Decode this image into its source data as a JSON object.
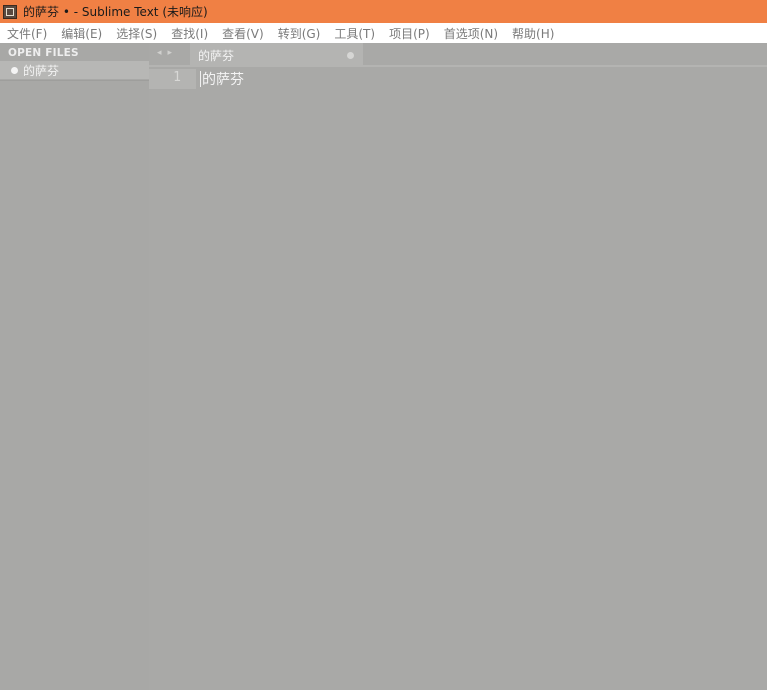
{
  "window": {
    "title": "的萨芬 • - Sublime Text (未响应)"
  },
  "menu": {
    "items": [
      {
        "label": "文件(F)"
      },
      {
        "label": "编辑(E)"
      },
      {
        "label": "选择(S)"
      },
      {
        "label": "查找(I)"
      },
      {
        "label": "查看(V)"
      },
      {
        "label": "转到(G)"
      },
      {
        "label": "工具(T)"
      },
      {
        "label": "项目(P)"
      },
      {
        "label": "首选项(N)"
      },
      {
        "label": "帮助(H)"
      }
    ]
  },
  "sidebar": {
    "header": "OPEN FILES",
    "files": [
      {
        "name": "的萨芬",
        "modified": true
      }
    ]
  },
  "tabs": {
    "nav_prev": "◂",
    "nav_next": "▸",
    "items": [
      {
        "label": "的萨芬",
        "modified": true
      }
    ]
  },
  "editor": {
    "lines": [
      {
        "number": "1",
        "text": "的萨芬"
      }
    ]
  },
  "colors": {
    "titlebar": "#f08044",
    "background": "#a9a9a7",
    "menubar": "#ffffff"
  }
}
